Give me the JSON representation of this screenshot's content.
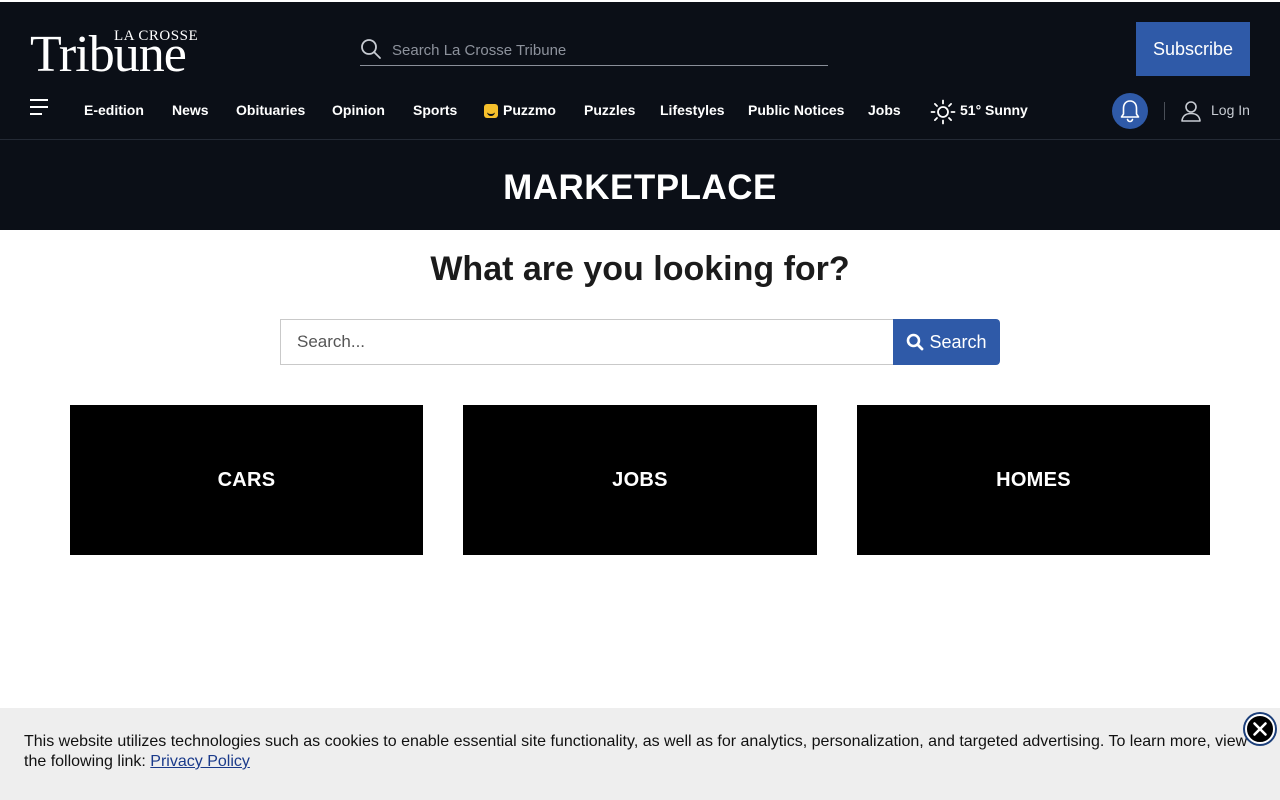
{
  "brand": {
    "logo_top": "LA CROSSE",
    "logo_main": "Tribune"
  },
  "header": {
    "search_placeholder": "Search La Crosse Tribune",
    "subscribe_label": "Subscribe"
  },
  "nav": {
    "items": [
      "E-edition",
      "News",
      "Obituaries",
      "Opinion",
      "Sports",
      "Puzzmo",
      "Puzzles",
      "Lifestyles",
      "Public Notices",
      "Jobs"
    ],
    "weather": "51° Sunny",
    "login_label": "Log In"
  },
  "page": {
    "title": "MARKETPLACE",
    "question": "What are you looking for?",
    "search_placeholder": "Search...",
    "search_button": "Search"
  },
  "tiles": [
    "CARS",
    "JOBS",
    "HOMES"
  ],
  "cookie_banner": {
    "text": "This website utilizes technologies such as cookies to enable essential site functionality, as well as for analytics, personalization, and targeted advertising. To learn more, view the following link: ",
    "link_text": "Privacy Policy"
  },
  "colors": {
    "header_bg": "#0b0f17",
    "accent_blue": "#2f5aa8",
    "tile_bg": "#000000",
    "cookie_bg": "#eeeeee"
  },
  "icons": [
    "search-icon",
    "menu-icon",
    "puzzmo-icon",
    "sun-icon",
    "bell-icon",
    "user-icon",
    "close-icon"
  ]
}
